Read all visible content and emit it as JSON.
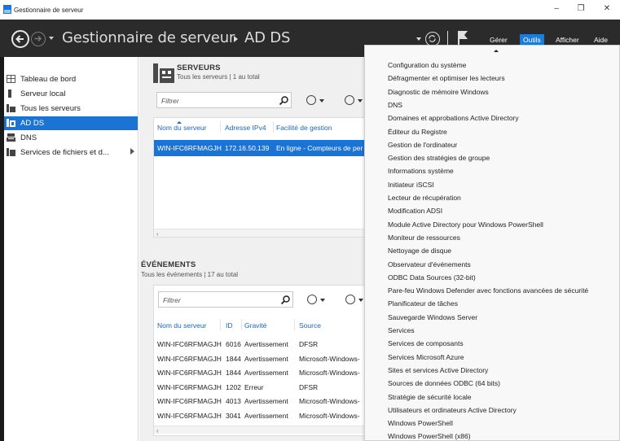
{
  "window": {
    "title": "Gestionnaire de serveur",
    "controls": {
      "minimize": "–",
      "restore": "❐",
      "close": "✕"
    }
  },
  "header": {
    "breadcrumb_app": "Gestionnaire de serveur",
    "breadcrumb_page": "AD DS",
    "menus": {
      "manage": "Gérer",
      "tools": "Outils",
      "view": "Afficher",
      "help": "Aide"
    }
  },
  "sidebar": {
    "items": [
      {
        "label": "Tableau de bord",
        "icon": "dashboard-icon"
      },
      {
        "label": "Serveur local",
        "icon": "server-icon"
      },
      {
        "label": "Tous les serveurs",
        "icon": "servers-icon"
      },
      {
        "label": "AD DS",
        "icon": "ad-ds-icon",
        "selected": true
      },
      {
        "label": "DNS",
        "icon": "dns-icon"
      },
      {
        "label": "Services de fichiers et d...",
        "icon": "file-services-icon",
        "has_submenu": true
      }
    ]
  },
  "servers": {
    "title": "SERVEURS",
    "subtitle": "Tous les serveurs | 1 au total",
    "filter_placeholder": "Filtrer",
    "columns": [
      "Nom du serveur",
      "Adresse IPv4",
      "Facilité de gestion"
    ],
    "rows": [
      {
        "name": "WIN-IFC6RFMAGJH",
        "ip": "172.16.50.139",
        "status": "En ligne - Compteurs de per"
      }
    ]
  },
  "events": {
    "title": "ÉVÉNEMENTS",
    "subtitle": "Tous les événements | 17 au total",
    "filter_placeholder": "Filtrer",
    "columns": [
      "Nom du serveur",
      "ID",
      "Gravité",
      "Source"
    ],
    "rows": [
      {
        "server": "WIN-IFC6RFMAGJH",
        "id": "6016",
        "severity": "Avertissement",
        "source": "DFSR"
      },
      {
        "server": "WIN-IFC6RFMAGJH",
        "id": "1844",
        "severity": "Avertissement",
        "source": "Microsoft-Windows-"
      },
      {
        "server": "WIN-IFC6RFMAGJH",
        "id": "1844",
        "severity": "Avertissement",
        "source": "Microsoft-Windows-"
      },
      {
        "server": "WIN-IFC6RFMAGJH",
        "id": "1202",
        "severity": "Erreur",
        "source": "DFSR"
      },
      {
        "server": "WIN-IFC6RFMAGJH",
        "id": "4013",
        "severity": "Avertissement",
        "source": "Microsoft-Windows-"
      },
      {
        "server": "WIN-IFC6RFMAGJH",
        "id": "3041",
        "severity": "Avertissement",
        "source": "Microsoft-Windows-"
      }
    ]
  },
  "tools_menu": {
    "items": [
      "Configuration du système",
      "Défragmenter et optimiser les lecteurs",
      "Diagnostic de mémoire Windows",
      "DNS",
      "Domaines et approbations Active Directory",
      "Éditeur du Registre",
      "Gestion de l'ordinateur",
      "Gestion des stratégies de groupe",
      "Informations système",
      "Initiateur iSCSI",
      "Lecteur de récupération",
      "Modification ADSI",
      "Module Active Directory pour Windows PowerShell",
      "Moniteur de ressources",
      "Nettoyage de disque",
      "Observateur d'événements",
      "ODBC Data Sources (32-bit)",
      "Pare-feu Windows Defender avec fonctions avancées de sécurité",
      "Planificateur de tâches",
      "Sauvegarde Windows Server",
      "Services",
      "Services de composants",
      "Services Microsoft Azure",
      "Sites et services Active Directory",
      "Sources de données ODBC (64 bits)",
      "Stratégie de sécurité locale",
      "Utilisateurs et ordinateurs Active Directory",
      "Windows PowerShell",
      "Windows PowerShell (x86)"
    ]
  },
  "colors": {
    "accent": "#1b74d4",
    "header_bg": "#2b2b2b",
    "link": "#1c67b5"
  }
}
